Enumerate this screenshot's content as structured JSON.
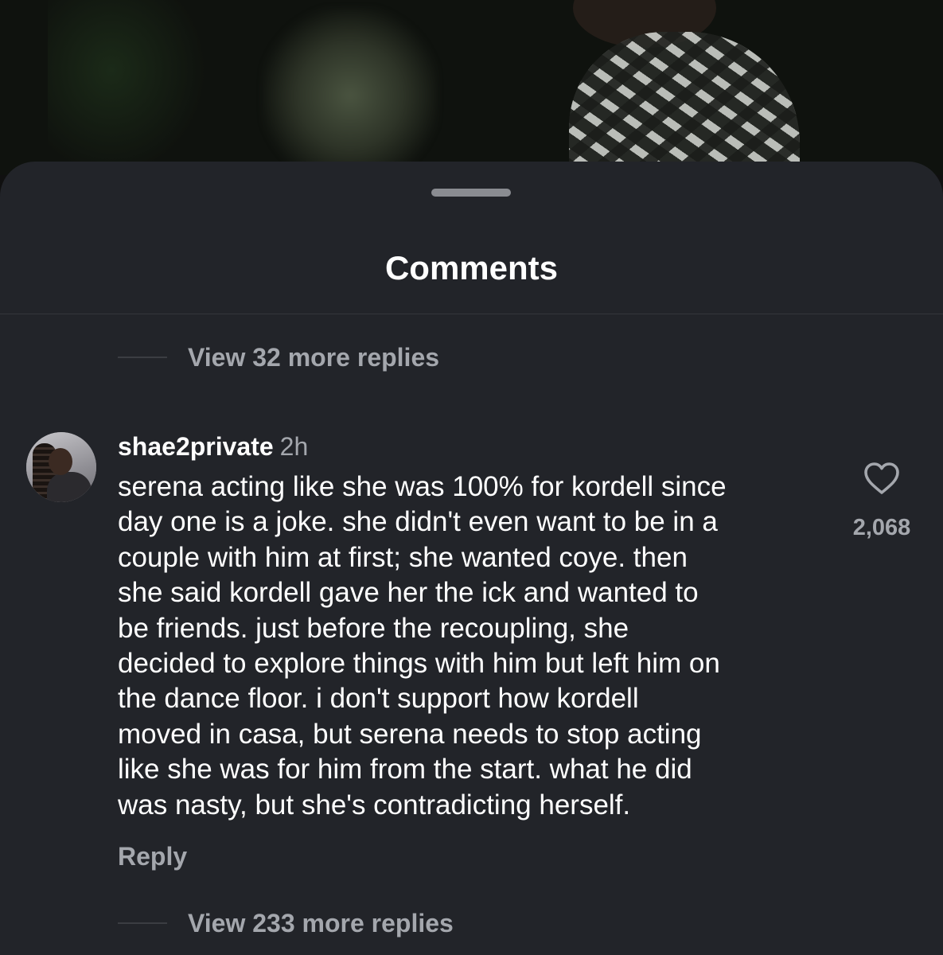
{
  "sheet": {
    "title": "Comments"
  },
  "thread": {
    "view_more_top": "View 32 more replies",
    "view_more_bottom": "View 233 more replies"
  },
  "comment": {
    "username": "shae2private",
    "time": "2h",
    "lines": [
      "serena acting like she was 100% for kordell since",
      "day one is a joke. she didn't even want to be in a",
      "couple with him at first; she wanted coye. then",
      "she said kordell gave her the ick and wanted to",
      "be friends. just before the recoupling, she",
      "decided to explore things with him but left him on",
      "the dance floor. i don't support how kordell",
      "moved in casa, but serena needs to stop acting",
      "like she was for him from the start. what he did",
      "was nasty, but she's contradicting herself."
    ],
    "reply_label": "Reply",
    "like_count": "2,068",
    "like_icon": "heart-outline-icon"
  },
  "colors": {
    "sheet_bg": "#222429",
    "text_primary": "#ffffff",
    "text_secondary": "#a4a7ad"
  }
}
